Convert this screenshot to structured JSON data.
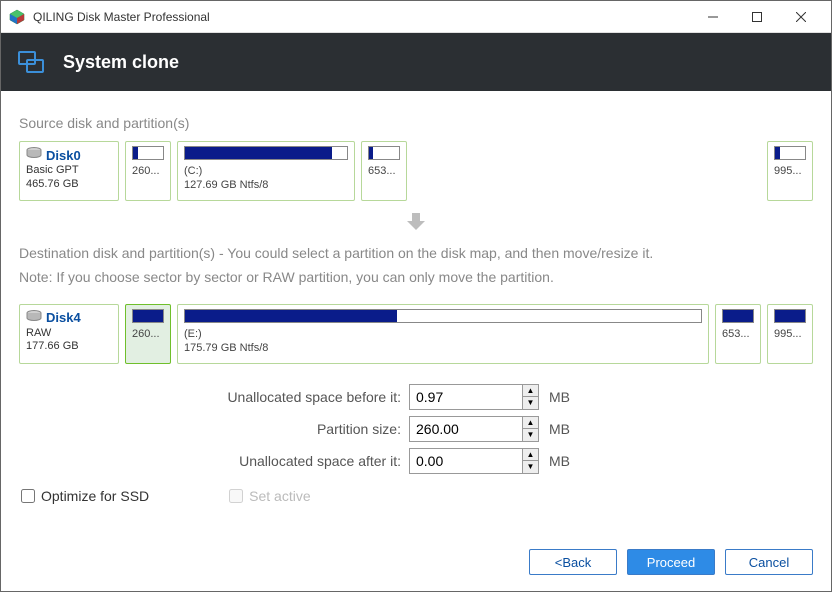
{
  "title": "QILING Disk Master Professional",
  "header": {
    "title": "System clone"
  },
  "source_label": "Source disk and partition(s)",
  "source_disk": {
    "name": "Disk0",
    "type": "Basic GPT",
    "size": "465.76 GB",
    "partitions": [
      {
        "cap": "260...",
        "fill": 16,
        "label": ""
      },
      {
        "cap": "127.69 GB Ntfs/8",
        "fill": 91,
        "label": "(C:)"
      },
      {
        "cap": "653...",
        "fill": 12,
        "label": ""
      },
      {
        "cap": "995...",
        "fill": 15,
        "label": ""
      }
    ]
  },
  "dest_text_line1": "Destination disk and partition(s) - You could select a partition on the disk map, and then move/resize it.",
  "dest_text_line2": "Note: If you choose sector by sector or RAW partition, you can only move the partition.",
  "dest_disk": {
    "name": "Disk4",
    "type": "RAW",
    "size": "177.66 GB",
    "partitions": [
      {
        "cap": "260...",
        "fill": 100,
        "label": "",
        "selected": true
      },
      {
        "cap": "175.79 GB Ntfs/8",
        "fill": 41,
        "label": "(E:)"
      },
      {
        "cap": "653...",
        "fill": 100,
        "label": ""
      },
      {
        "cap": "995...",
        "fill": 100,
        "label": ""
      }
    ]
  },
  "form": {
    "before_label": "Unallocated space before it:",
    "before_value": "0.97",
    "size_label": "Partition size:",
    "size_value": "260.00",
    "after_label": "Unallocated space after it:",
    "after_value": "0.00",
    "unit": "MB"
  },
  "checks": {
    "ssd": "Optimize for SSD",
    "active": "Set active"
  },
  "buttons": {
    "back": "<Back",
    "proceed": "Proceed",
    "cancel": "Cancel"
  }
}
